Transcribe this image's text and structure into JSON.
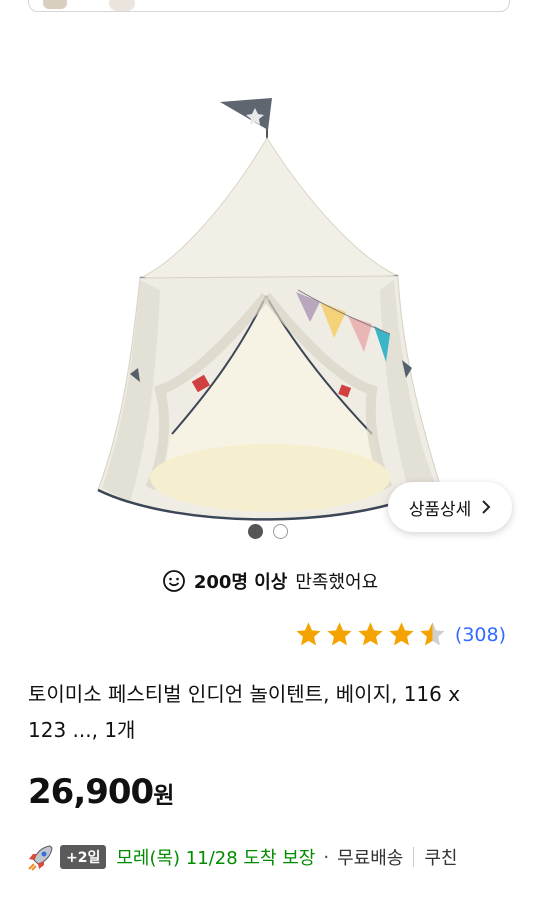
{
  "product": {
    "detail_button_label": "상품상세",
    "satisfaction": {
      "count_text": "200명 이상",
      "rest_text": "만족했어요"
    },
    "rating": {
      "stars": 4.5,
      "review_count": "(308)"
    },
    "title": "토이미소 페스티벌 인디언 놀이텐트, 베이지, 116 x 123 ..., 1개",
    "price": {
      "amount": "26,900",
      "unit": "원"
    },
    "delivery": {
      "badge": "+2일",
      "arrival": "모레(목) 11/28 도착 보장",
      "separator": "·",
      "free_shipping": "무료배송",
      "tag": "쿠친"
    },
    "carousel": {
      "current": 1,
      "total": 2
    }
  },
  "colors": {
    "accent_blue": "#346aff",
    "star_orange": "#f5a300",
    "arrival_green": "#008c00"
  },
  "icons": [
    "smile-icon",
    "star-icon",
    "chevron-right-icon",
    "rocket-icon"
  ]
}
